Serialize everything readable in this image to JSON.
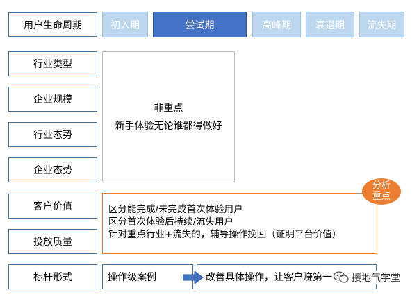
{
  "header": {
    "title": "用户生命周期",
    "stages": [
      "初入期",
      "尝试期",
      "高峰期",
      "衰退期",
      "流失期"
    ],
    "active_stage": "尝试期"
  },
  "rows": [
    "行业类型",
    "企业规模",
    "行业态势",
    "企业态势",
    "客户价值",
    "投放质量",
    "标杆形式"
  ],
  "panel_main": {
    "title": "非重点",
    "text": "新手体验无论谁都得做好"
  },
  "panel_key": {
    "badge_line1": "分析",
    "badge_line2": "重点",
    "lines": [
      "区分能完成/未完成首次体验用户",
      "区分首次体验后持续/流失用户",
      "针对重点行业+流失的，辅导操作挽回（证明平台价值）"
    ]
  },
  "benchmark": {
    "case_label": "操作级案例",
    "result_text": "改善具体操作，让客户赚第一桶"
  },
  "watermark": "接地气学堂",
  "colors": {
    "active": "#4472c4",
    "inactive": "#bdd7ee",
    "border": "#41719c",
    "accent": "#ed7d31"
  }
}
